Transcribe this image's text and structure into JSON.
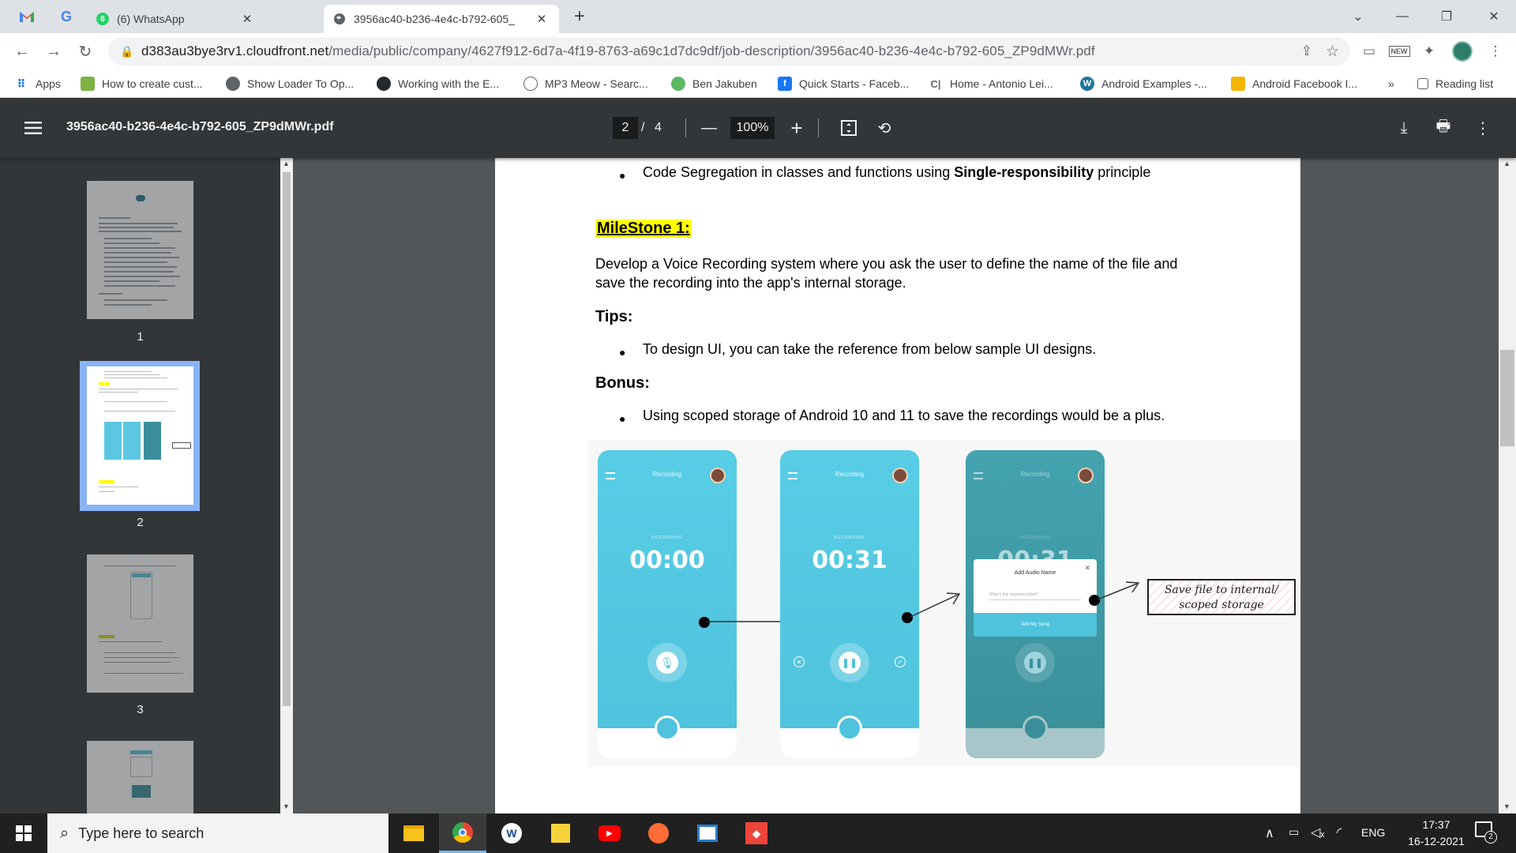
{
  "browser": {
    "pinned": [
      "Gmail",
      "Google"
    ],
    "tabs": [
      {
        "title": "(6) WhatsApp",
        "badge": "6"
      },
      {
        "title": "3956ac40-b236-4e4c-b792-605_"
      }
    ],
    "new_tab": "+",
    "url_host": "d383au3bye3rv1.cloudfront.net",
    "url_path": "/media/public/company/4627f912-6d7a-4f19-8763-a69c1d7dc9df/job-description/3956ac40-b236-4e4c-b792-605_ZP9dMWr.pdf"
  },
  "bookmarks": {
    "items": [
      "Apps",
      "How to create cust...",
      "Show Loader To Op...",
      "Working with the E...",
      "MP3 Meow - Searc...",
      "Ben Jakuben",
      "Quick Starts - Faceb...",
      "Home - Antonio Lei...",
      "Android Examples -...",
      "Android Facebook I..."
    ],
    "more": "»",
    "reading_list": "Reading list"
  },
  "pdf": {
    "filename": "3956ac40-b236-4e4c-b792-605_ZP9dMWr.pdf",
    "current_page": "2",
    "separator": "/",
    "total_pages": "4",
    "zoom": "100%",
    "thumb_labels": [
      "1",
      "2",
      "3"
    ],
    "content": {
      "bullet1_pre": "Code Segregation in classes and functions using ",
      "bullet1_bold": "Single-responsibility",
      "bullet1_post": " principle",
      "milestone": "MileStone 1:",
      "para_line1": "Develop a Voice Recording system where you ask the user to define the name of the file and",
      "para_line2": "save the recording into the app's internal storage.",
      "tips_heading": "Tips:",
      "tips_bullet": "To design UI, you can take the reference from below sample UI designs.",
      "bonus_heading": "Bonus:",
      "bonus_bullet": "Using scoped storage of Android 10 and 11 to save the recordings would be a plus.",
      "phones": [
        {
          "timer": "00:00",
          "header": "Recording",
          "label": "RECORDING"
        },
        {
          "timer": "00:31",
          "header": "Recording",
          "label": "RECORDING"
        },
        {
          "timer": "00:31",
          "header": "Recording",
          "label": "RECORDING"
        }
      ],
      "dialog_title": "Add Audio Name",
      "dialog_placeholder": "What's this segment called?",
      "dialog_button": "Add My Song",
      "callout_line1": "Save file to internal/",
      "callout_line2": "scoped storage"
    }
  },
  "taskbar": {
    "search_placeholder": "Type here to search",
    "language": "ENG",
    "time": "17:37",
    "date": "16-12-2021",
    "notifications": "2"
  }
}
